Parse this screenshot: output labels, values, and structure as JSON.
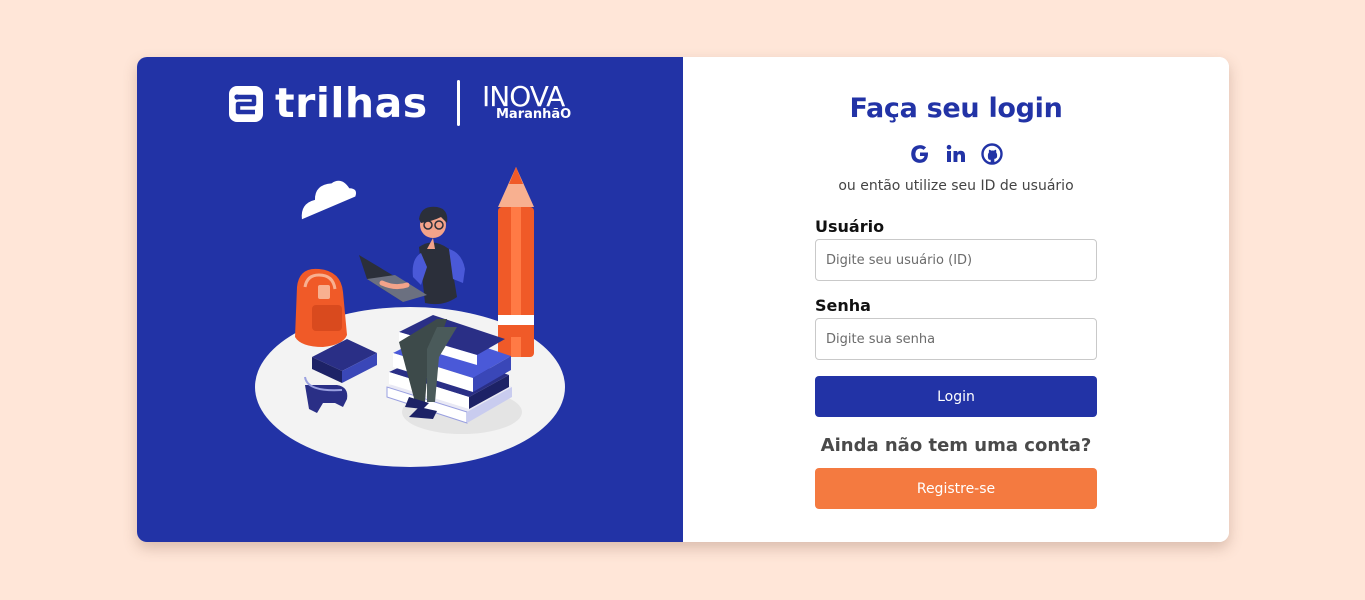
{
  "brand": {
    "trilhas_logo": "trilhas",
    "inova_logo_top": "INOVA",
    "inova_logo_bottom": "MaranhãO"
  },
  "login": {
    "title": "Faça seu login",
    "social": [
      {
        "icon": "google-icon",
        "label": "G"
      },
      {
        "icon": "linkedin-icon",
        "label": "in"
      },
      {
        "icon": "github-icon",
        "label": "GitHub"
      }
    ],
    "alt_text": "ou então utilize seu ID de usuário",
    "user_label": "Usuário",
    "user_placeholder": "Digite seu usuário (ID)",
    "user_value": "",
    "password_label": "Senha",
    "password_placeholder": "Digite sua senha",
    "password_value": "",
    "login_button": "Login",
    "no_account_text": "Ainda não tem uma conta?",
    "register_button": "Registre-se"
  },
  "colors": {
    "page_background": "#ffe6d8",
    "panel_blue": "#2233a6",
    "accent_orange": "#f47a40",
    "card_white": "#ffffff"
  }
}
